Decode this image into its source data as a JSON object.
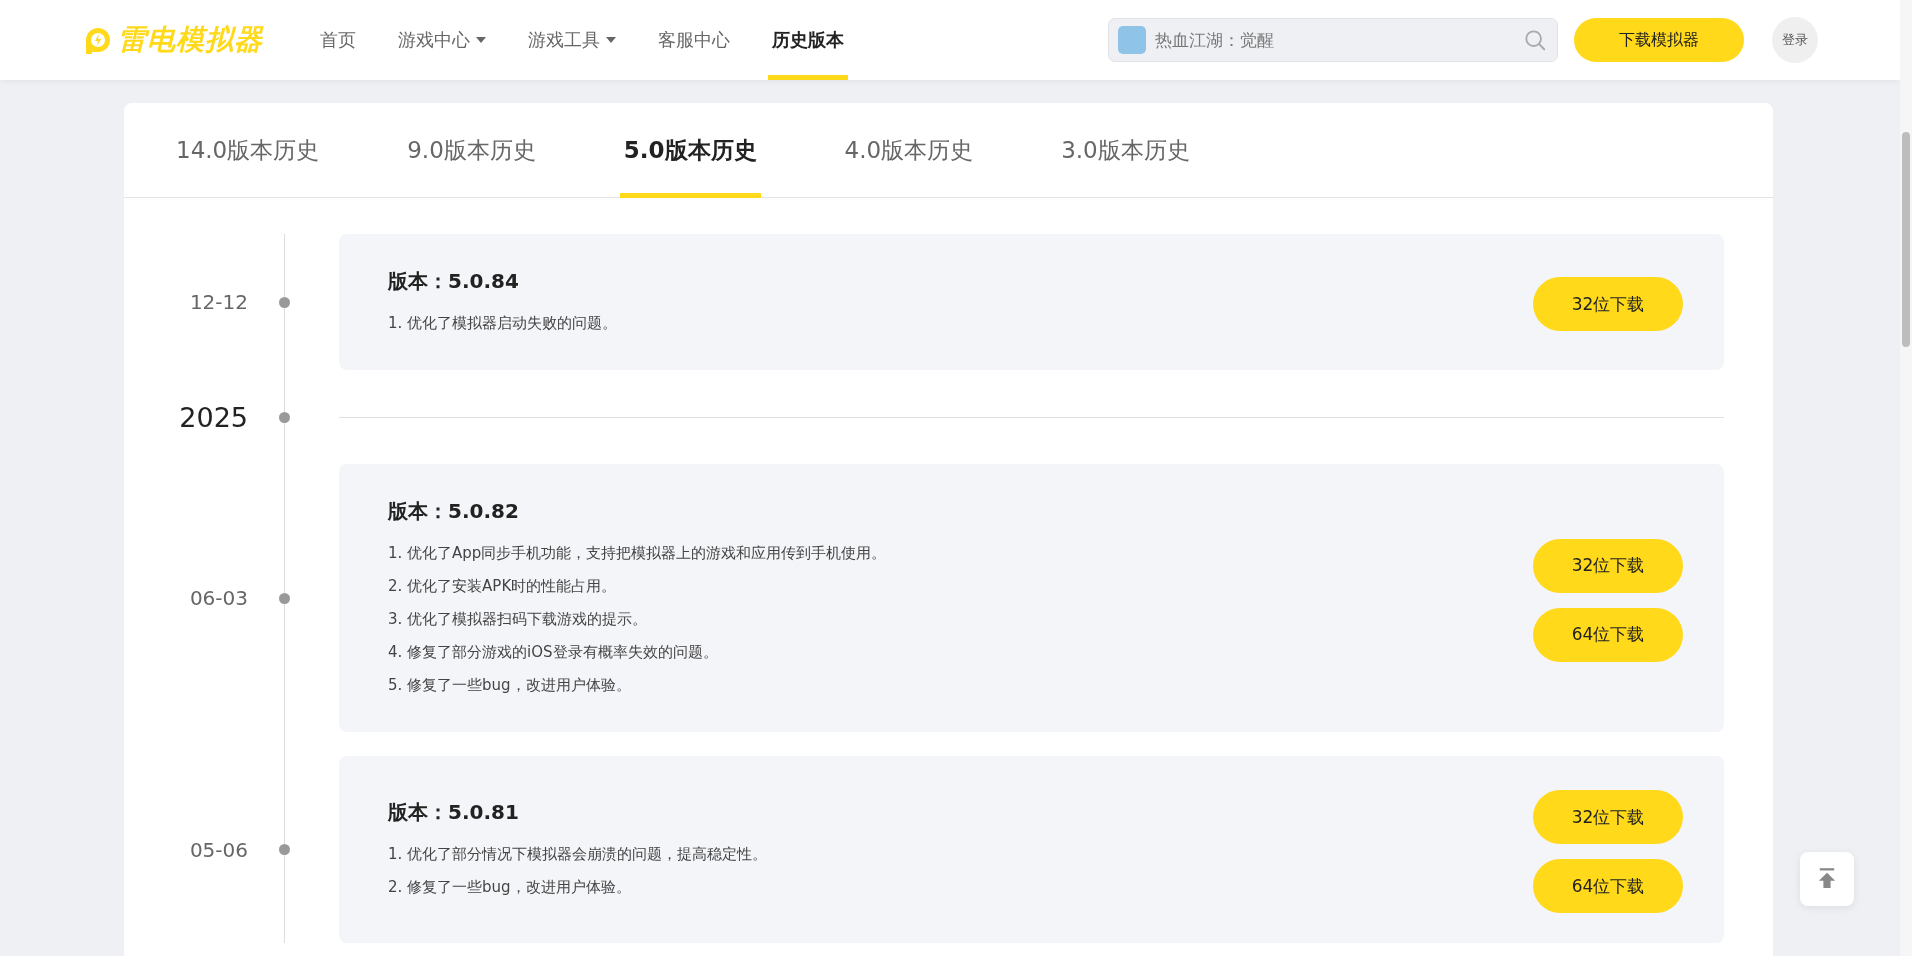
{
  "header": {
    "logo": "雷电模拟器",
    "nav": [
      {
        "label": "首页",
        "selected": false,
        "dropdown": false
      },
      {
        "label": "游戏中心",
        "selected": false,
        "dropdown": true
      },
      {
        "label": "游戏工具",
        "selected": false,
        "dropdown": true
      },
      {
        "label": "客服中心",
        "selected": false,
        "dropdown": false
      },
      {
        "label": "历史版本",
        "selected": true,
        "dropdown": false
      }
    ],
    "search": {
      "placeholder": "热血江湖：觉醒"
    },
    "download_button": "下载模拟器",
    "login_button": "登录"
  },
  "version_tabs": [
    {
      "label": "14.0版本历史",
      "selected": false
    },
    {
      "label": "9.0版本历史",
      "selected": false
    },
    {
      "label": "5.0版本历史",
      "selected": true
    },
    {
      "label": "4.0版本历史",
      "selected": false
    },
    {
      "label": "3.0版本历史",
      "selected": false
    }
  ],
  "timeline": [
    {
      "kind": "release",
      "date": "12-12",
      "title": "版本：5.0.84",
      "notes": [
        "1. 优化了模拟器启动失败的问题。"
      ],
      "buttons": [
        "32位下载"
      ]
    },
    {
      "kind": "year",
      "year": "2025"
    },
    {
      "kind": "release",
      "date": "06-03",
      "title": "版本：5.0.82",
      "notes": [
        "1. 优化了App同步手机功能，支持把模拟器上的游戏和应用传到手机使用。",
        "2. 优化了安装APK时的性能占用。",
        "3. 优化了模拟器扫码下载游戏的提示。",
        "4. 修复了部分游戏的iOS登录有概率失效的问题。",
        "5. 修复了一些bug，改进用户体验。"
      ],
      "buttons": [
        "32位下载",
        "64位下载"
      ]
    },
    {
      "kind": "release",
      "date": "05-06",
      "title": "版本：5.0.81",
      "notes": [
        "1. 优化了部分情况下模拟器会崩溃的问题，提高稳定性。",
        "2. 修复了一些bug，改进用户体验。"
      ],
      "buttons": [
        "32位下载",
        "64位下载"
      ]
    }
  ]
}
